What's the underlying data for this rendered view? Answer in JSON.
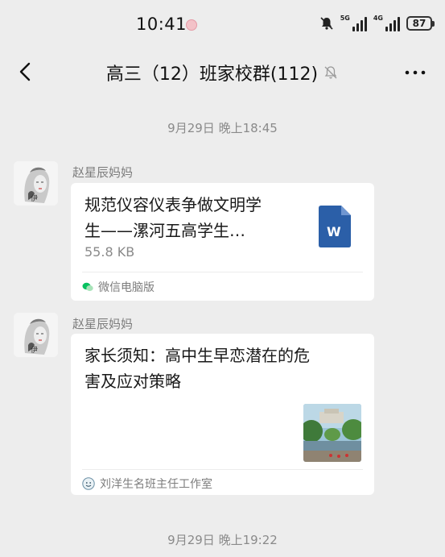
{
  "status_bar": {
    "time": "10:41",
    "network1": "5G",
    "network2": "4G",
    "battery": "87"
  },
  "header": {
    "title": "高三（12）班家校群(112)"
  },
  "messages": [
    {
      "timestamp": "9月29日 晚上18:45",
      "sender": "赵星辰妈妈",
      "title_line1": "规范仪容仪表争做文明学",
      "title_line2": "生——漯河五高学生…",
      "meta": "55.8 KB",
      "file_icon": "W",
      "source": "微信电脑版"
    },
    {
      "sender": "赵星辰妈妈",
      "title_line1": "家长须知：高中生早恋潜在的危",
      "title_line2": "害及应对策略",
      "source": "刘洋生名班主任工作室"
    }
  ],
  "footer_timestamp": "9月29日 晚上19:22",
  "colors": {
    "background": "#ededed",
    "card": "#ffffff",
    "word_blue": "#2b5fa8",
    "wechat_green": "#07c160"
  }
}
